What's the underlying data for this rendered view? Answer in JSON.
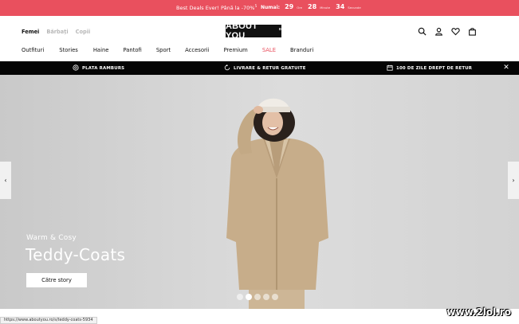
{
  "promo": {
    "message": "Best Deals Ever! Până la -70%",
    "footnote_mark": "5",
    "countdown_label": "Numai:",
    "countdown": [
      {
        "value": "29",
        "unit": "Ore"
      },
      {
        "value": "28",
        "unit": "Minute"
      },
      {
        "value": "34",
        "unit": "Secunde"
      }
    ]
  },
  "header": {
    "gender_tabs": [
      {
        "label": "Femei",
        "active": true
      },
      {
        "label": "Bărbați",
        "active": false
      },
      {
        "label": "Copii",
        "active": false
      }
    ],
    "logo_text": "ABOUT YOU",
    "logo_mark": "o",
    "icons": [
      "search-icon",
      "user-icon",
      "heart-icon",
      "bag-icon"
    ]
  },
  "nav": {
    "items": [
      "Outfituri",
      "Stories",
      "Haine",
      "Pantofi",
      "Sport",
      "Accesorii",
      "Premium",
      "SALE",
      "Branduri"
    ],
    "sale_color": "#e9505e"
  },
  "benefits": {
    "items": [
      {
        "icon": "cash-icon",
        "label": "PLATA RAMBURS"
      },
      {
        "icon": "return-icon",
        "label": "LIVRARE & RETUR GRATUITE"
      },
      {
        "icon": "calendar-icon",
        "label": "100 DE ZILE DREPT DE RETUR"
      }
    ],
    "close_glyph": "✕"
  },
  "hero": {
    "tagline": "Warm & Cosy",
    "headline": "Teddy-Coats",
    "cta_label": "Către story",
    "prev_glyph": "‹",
    "next_glyph": "›",
    "slide_count": 5,
    "active_slide": 2
  },
  "status_bar": {
    "url": "https://www.aboutyou.ro/s/teddy-coats-5934"
  },
  "watermark": "www.2lol.ro"
}
